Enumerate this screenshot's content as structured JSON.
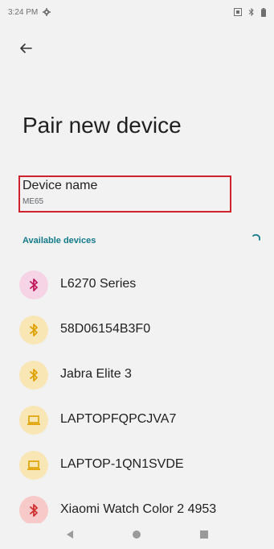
{
  "status": {
    "time": "3:24 PM"
  },
  "page": {
    "title": "Pair new device"
  },
  "device_name": {
    "label": "Device name",
    "value": "ME65"
  },
  "available": {
    "header": "Available devices"
  },
  "devices": [
    {
      "name": "L6270 Series",
      "icon": "bluetooth-icon",
      "icon_bg": "#f7d3e6",
      "icon_color": "#c2185b"
    },
    {
      "name": "58D06154B3F0",
      "icon": "bluetooth-icon",
      "icon_bg": "#f8e6b5",
      "icon_color": "#e0a000"
    },
    {
      "name": "Jabra Elite 3",
      "icon": "bluetooth-icon",
      "icon_bg": "#f8e6b5",
      "icon_color": "#e0a000"
    },
    {
      "name": "LAPTOPFQPCJVA7",
      "icon": "laptop-icon",
      "icon_bg": "#f8e6b5",
      "icon_color": "#e0a000"
    },
    {
      "name": "LAPTOP-1QN1SVDE",
      "icon": "laptop-icon",
      "icon_bg": "#f8e6b5",
      "icon_color": "#e0a000"
    },
    {
      "name": "Xiaomi Watch Color 2 4953",
      "icon": "bluetooth-icon",
      "icon_bg": "#f7c9c9",
      "icon_color": "#d32f2f"
    }
  ],
  "colors": {
    "accent": "#137a8a",
    "highlight_box": "#d0222c"
  }
}
